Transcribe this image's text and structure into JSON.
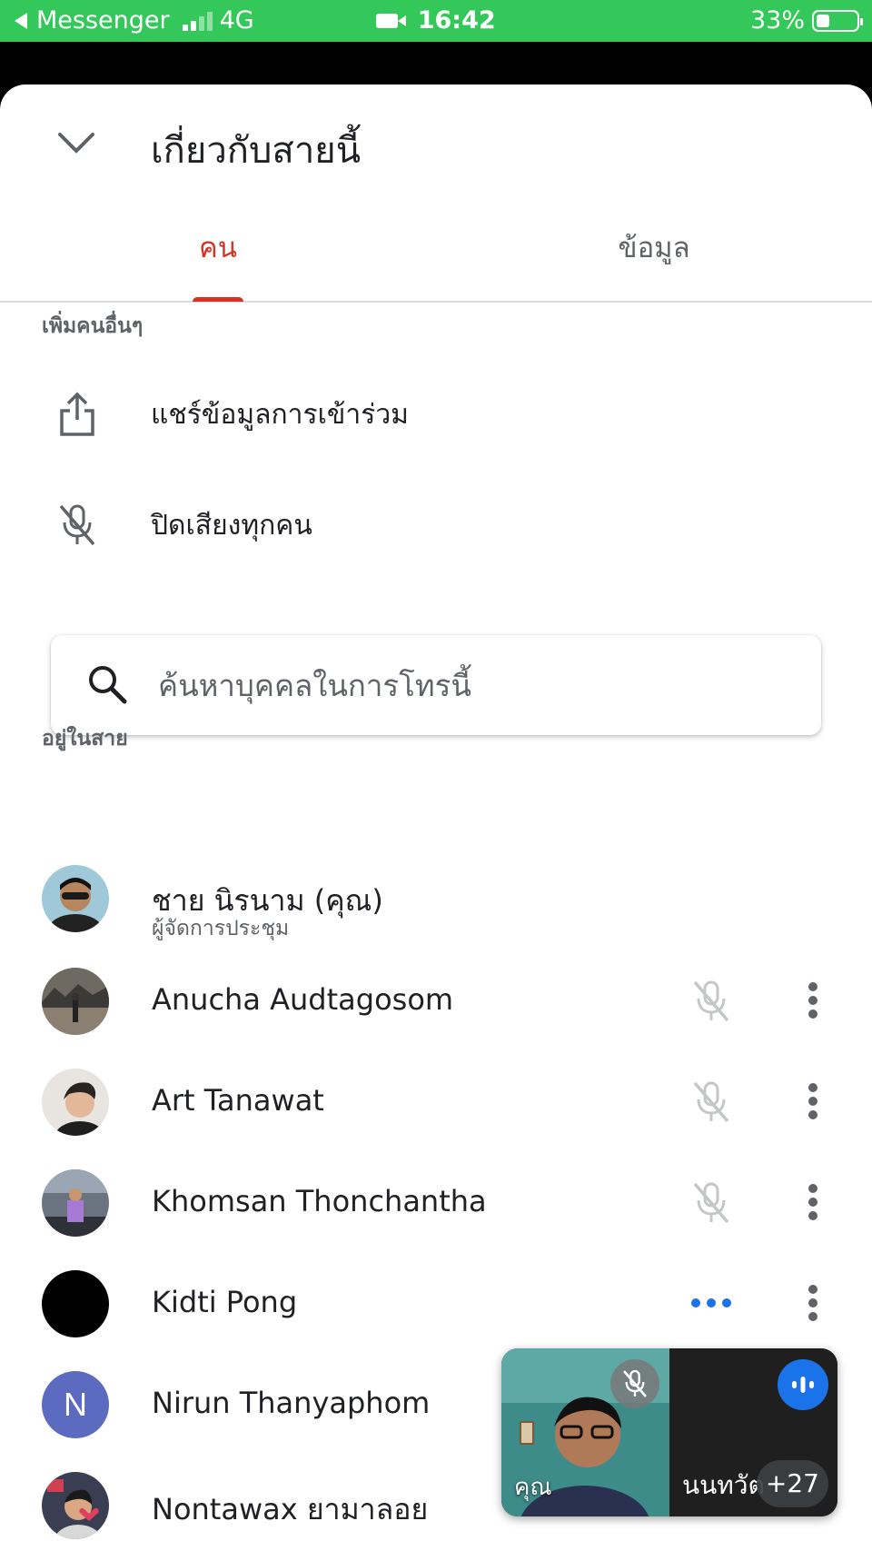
{
  "status_bar": {
    "back_app": "Messenger",
    "network": "4G",
    "time": "16:42",
    "battery": "33%"
  },
  "header": {
    "title": "เกี่ยวกับสายนี้"
  },
  "tabs": [
    {
      "label": "คน",
      "active": true
    },
    {
      "label": "ข้อมูล",
      "active": false
    }
  ],
  "add_others": {
    "section_label": "เพิ่มคนอื่นๆ",
    "share_label": "แชร์ข้อมูลการเข้าร่วม",
    "mute_all_label": "ปิดเสียงทุกคน"
  },
  "search": {
    "placeholder": "ค้นหาบุคคลในการโทรนี้"
  },
  "in_call": {
    "section_label": "อยู่ในสาย",
    "people": [
      {
        "name": "ชาย นิรนาม (คุณ)",
        "subtitle": "ผู้จัดการประชุม",
        "mic": "none"
      },
      {
        "name": "Anucha Audtagosom",
        "mic": "muted"
      },
      {
        "name": "Art Tanawat",
        "mic": "muted"
      },
      {
        "name": "Khomsan Thonchantha",
        "mic": "muted"
      },
      {
        "name": "Kidti Pong",
        "mic": "speaking"
      },
      {
        "name": "Nirun Thanyaphom",
        "initial": "N",
        "mic": "hidden"
      },
      {
        "name": "Nontawax ยามาลอย",
        "mic": "hidden"
      }
    ]
  },
  "pip": {
    "self_label": "คุณ",
    "other_label": "นนทวัต",
    "more_count": "+27"
  },
  "colors": {
    "accent": "#d93025",
    "status_bar": "#34c759",
    "speaking_blue": "#1a73e8"
  }
}
